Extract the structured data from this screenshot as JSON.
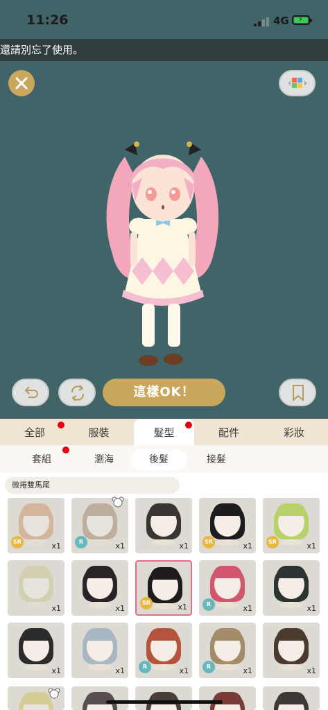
{
  "status_bar": {
    "time": "11:26",
    "network": "4G"
  },
  "notice": "還請別忘了使用。",
  "ok_button": "這樣OK！",
  "tabs": [
    {
      "label": "全部"
    },
    {
      "label": "服裝"
    },
    {
      "label": "髮型"
    },
    {
      "label": "配件"
    },
    {
      "label": "彩妝"
    }
  ],
  "subtabs": [
    {
      "label": "套組"
    },
    {
      "label": "瀏海"
    },
    {
      "label": "後髮"
    },
    {
      "label": "接髮"
    }
  ],
  "filter_label": "微捲雙馬尾",
  "items": [
    {
      "rarity": "SR",
      "qty": "x1",
      "hair": "#c98a5b",
      "faded": true
    },
    {
      "rarity": "R",
      "qty": "x1",
      "hair": "#9c7a5c",
      "faded": true
    },
    {
      "rarity": "",
      "qty": "x1",
      "hair": "#3a3432",
      "faded": false
    },
    {
      "rarity": "SR",
      "qty": "x1",
      "hair": "#1e1c1f",
      "faded": false
    },
    {
      "rarity": "SR",
      "qty": "x1",
      "hair": "#b8d26a",
      "faded": false
    },
    {
      "rarity": "",
      "qty": "x1",
      "hair": "#c9c48a",
      "faded": true
    },
    {
      "rarity": "",
      "qty": "x1",
      "hair": "#2a2428",
      "faded": false
    },
    {
      "rarity": "SR",
      "qty": "x1",
      "hair": "#1f1b1d",
      "faded": false
    },
    {
      "rarity": "R",
      "qty": "x1",
      "hair": "#d2566d",
      "faded": false
    },
    {
      "rarity": "",
      "qty": "x1",
      "hair": "#2d3331",
      "faded": false
    },
    {
      "rarity": "",
      "qty": "x1",
      "hair": "#2b2b2b",
      "faded": false
    },
    {
      "rarity": "",
      "qty": "x1",
      "hair": "#a9b7c2",
      "faded": false
    },
    {
      "rarity": "R",
      "qty": "x1",
      "hair": "#b4543e",
      "faded": false
    },
    {
      "rarity": "R",
      "qty": "x1",
      "hair": "#a38b6a",
      "faded": false
    },
    {
      "rarity": "",
      "qty": "x1",
      "hair": "#4a3b30",
      "faded": false
    },
    {
      "rarity": "",
      "qty": "",
      "hair": "#c9c04a",
      "faded": true
    },
    {
      "rarity": "",
      "qty": "",
      "hair": "#585050",
      "faded": false
    },
    {
      "rarity": "",
      "qty": "",
      "hair": "#4a3e3a",
      "faded": false
    },
    {
      "rarity": "",
      "qty": "",
      "hair": "#7a3a36",
      "faded": false
    },
    {
      "rarity": "",
      "qty": "",
      "hair": "#3e3936",
      "faded": false
    }
  ],
  "colors": {
    "stage_bg": "#416468",
    "gold": "#c9a75c",
    "tab_bg": "#efe5d2",
    "selected_border": "#e26c86",
    "badge_red": "#e60012"
  }
}
